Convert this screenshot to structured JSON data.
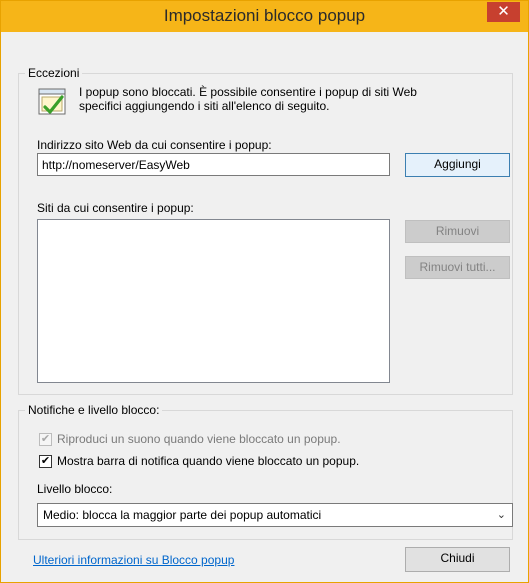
{
  "window": {
    "title": "Impostazioni blocco popup",
    "close_symbol": "✕"
  },
  "exceptions": {
    "legend": "Eccezioni",
    "info_icon": "info-check-icon",
    "info_line1": "I popup sono bloccati. È possibile consentire i popup di siti Web",
    "info_line2": "specifici aggiungendo i siti all'elenco di seguito.",
    "address_label": "Indirizzo sito Web da cui consentire i popup:",
    "address_value": "http://nomeserver/EasyWeb",
    "add_button": "Aggiungi",
    "allowed_sites_label": "Siti da cui consentire i popup:",
    "allowed_sites": [],
    "remove_button": "Rimuovi",
    "remove_all_button": "Rimuovi tutti..."
  },
  "notifications": {
    "legend": "Notifiche e livello blocco:",
    "play_sound_label": "Riproduci un suono quando viene bloccato un popup.",
    "play_sound_checked": true,
    "show_bar_label": "Mostra barra di notifica quando viene bloccato un popup.",
    "show_bar_checked": true,
    "block_level_label": "Livello blocco:",
    "block_level_value": "Medio: blocca la maggior parte dei popup automatici"
  },
  "footer": {
    "info_link": "Ulteriori informazioni su Blocco popup",
    "close_button": "Chiudi"
  },
  "colors": {
    "titlebar": "#f6b518",
    "close": "#c7402f",
    "link": "#0066cc"
  }
}
